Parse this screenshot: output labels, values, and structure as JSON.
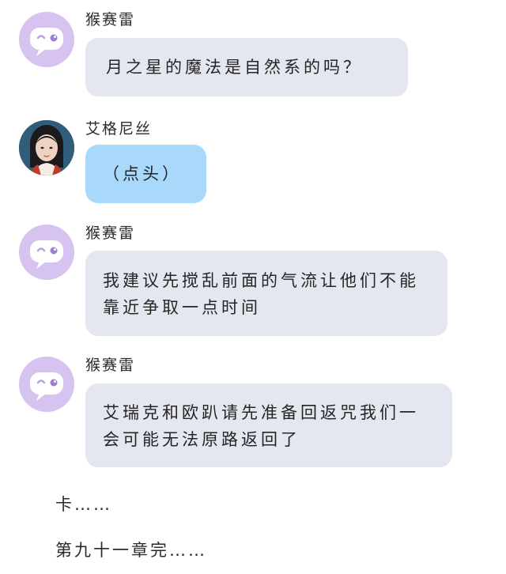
{
  "messages": [
    {
      "name": "猴赛雷",
      "text": "月之星的魔法是自然系的吗？",
      "avatar": "bot-avatar-icon"
    },
    {
      "name": "艾格尼丝",
      "text": "（点头）",
      "avatar": "profile-photo"
    },
    {
      "name": "猴赛雷",
      "text": "我建议先搅乱前面的气流让他们不能靠近争取一点时间",
      "avatar": "bot-avatar-icon"
    },
    {
      "name": "猴赛雷",
      "text": "艾瑞克和欧趴请先准备回返咒我们一会可能无法原路返回了",
      "avatar": "bot-avatar-icon"
    }
  ],
  "footer": {
    "line1": "卡……",
    "line2": "第九十一章完……"
  },
  "colors": {
    "bubble_gray": "#e4e7ef",
    "bubble_blue": "#a8d9fb",
    "avatar_purple": "#d6c3ef"
  }
}
